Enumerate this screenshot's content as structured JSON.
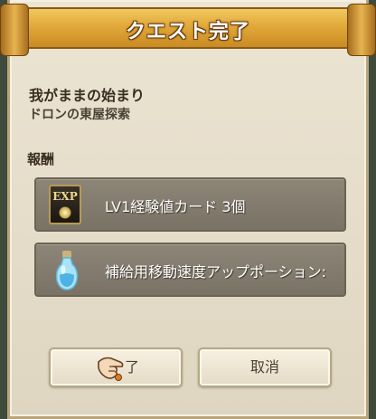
{
  "dialog": {
    "title": "クエスト完了",
    "quest_name": "我がままの始まり",
    "quest_sub": "ドロンの東屋探索",
    "reward_label": "報酬",
    "rewards": [
      {
        "icon": "exp-card-icon",
        "icon_text": "EXP",
        "text": "LV1経験値カード 3個"
      },
      {
        "icon": "potion-icon",
        "text": "補給用移動速度アップポーション:"
      }
    ],
    "buttons": {
      "ok_label": "了",
      "cancel_label": "取消"
    }
  }
}
